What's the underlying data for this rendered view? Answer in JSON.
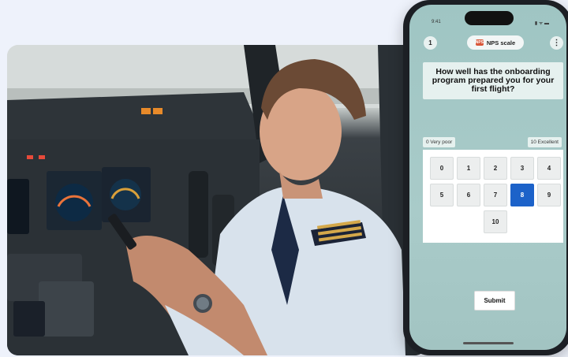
{
  "status_bar": {
    "time": "9:41",
    "icons": "▮ ᯤ ▬"
  },
  "header": {
    "question_number": "1",
    "scale_badge_icon_text": "NPS",
    "scale_badge_label": "NPS scale",
    "more_icon": "⋮"
  },
  "question": {
    "text": "How well has the onboarding program prepared you for your first flight?"
  },
  "scale": {
    "low_label": "0 Very poor",
    "high_label": "10 Excellent",
    "options": [
      "0",
      "1",
      "2",
      "3",
      "4",
      "5",
      "6",
      "7",
      "8",
      "9",
      "10"
    ],
    "selected": "8"
  },
  "submit_label": "Submit",
  "colors": {
    "accent": "#1c62c9",
    "screen_bg": "#a2c4c2"
  }
}
